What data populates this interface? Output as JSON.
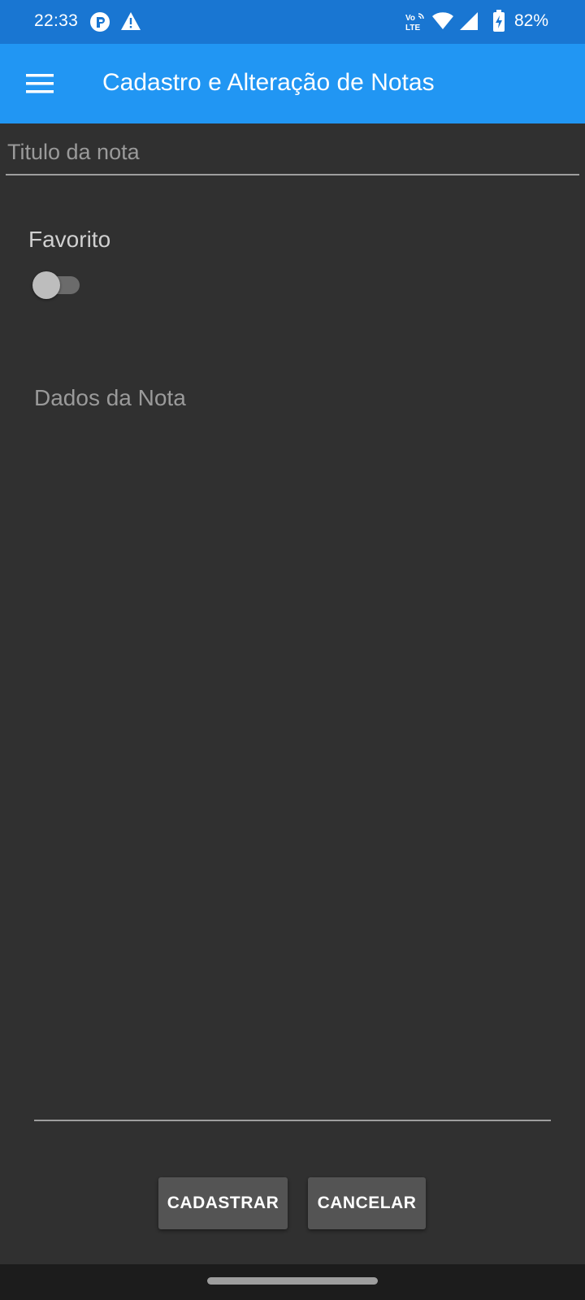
{
  "status_bar": {
    "time": "22:33",
    "battery": "82%",
    "icons": [
      "app-notification-icon",
      "warning-icon",
      "volte-icon",
      "wifi-icon",
      "signal-icon",
      "battery-charging-icon"
    ],
    "background": "#1976d2"
  },
  "app_bar": {
    "title": "Cadastro e Alteração de Notas",
    "menu_icon": "hamburger-menu-icon",
    "background": "#2196f3"
  },
  "form": {
    "title_placeholder": "Titulo da nota",
    "title_value": "",
    "favorite_label": "Favorito",
    "favorite_on": false,
    "data_placeholder": "Dados da Nota",
    "data_value": ""
  },
  "actions": {
    "save_label": "CADASTRAR",
    "cancel_label": "CANCELAR"
  },
  "theme": {
    "background": "#303030",
    "button": "#545454"
  }
}
